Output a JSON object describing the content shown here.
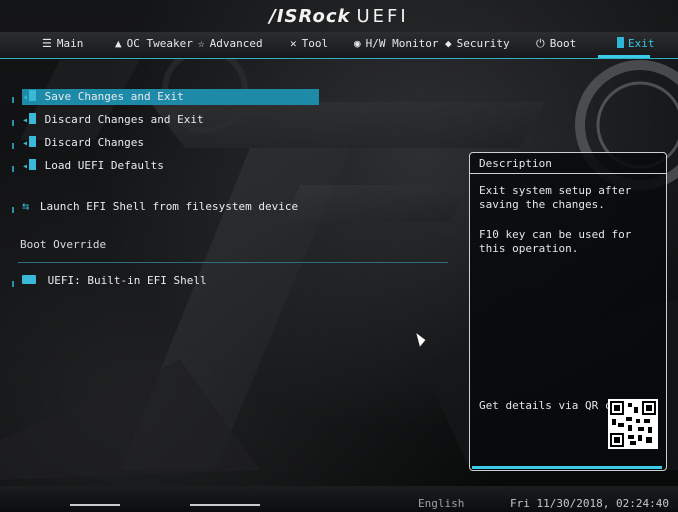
{
  "header": {
    "brand": "/ISRock",
    "product": "UEFI"
  },
  "tabs": [
    {
      "label": "Main",
      "icon": "list-icon"
    },
    {
      "label": "OC Tweaker",
      "icon": "rocket-icon"
    },
    {
      "label": "Advanced",
      "icon": "star-icon"
    },
    {
      "label": "Tool",
      "icon": "wrench-icon"
    },
    {
      "label": "H/W Monitor",
      "icon": "monitor-icon"
    },
    {
      "label": "Security",
      "icon": "shield-icon"
    },
    {
      "label": "Boot",
      "icon": "power-icon"
    },
    {
      "label": "Exit",
      "icon": "exit-icon",
      "active": true
    }
  ],
  "menu": {
    "items": [
      {
        "label": "Save Changes and Exit",
        "selected": true
      },
      {
        "label": "Discard Changes and Exit"
      },
      {
        "label": "Discard Changes"
      },
      {
        "label": "Load UEFI Defaults"
      },
      {
        "label": "Launch EFI Shell from filesystem device"
      }
    ],
    "section_title": "Boot Override",
    "boot_items": [
      {
        "label": "UEFI: Built-in EFI Shell"
      }
    ]
  },
  "description": {
    "title": "Description",
    "paragraph1": "Exit system setup after saving the changes.",
    "paragraph2": "F10 key can be used for this operation.",
    "qr_label": "Get details via QR code"
  },
  "footer": {
    "language": "English",
    "datetime": "Fri 11/30/2018, 02:24:40"
  },
  "colors": {
    "accent": "#2fb5d6",
    "selection": "#1d8aa8"
  }
}
